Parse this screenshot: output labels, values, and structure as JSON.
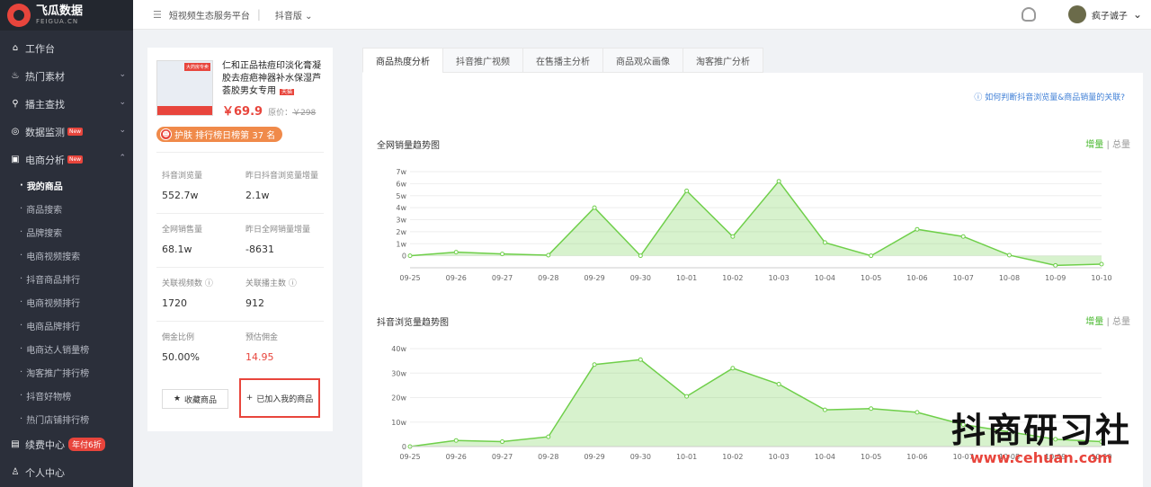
{
  "app": {
    "logo_name": "飞瓜数据",
    "logo_sub": "FEIGUA.CN"
  },
  "topbar": {
    "menu_icon": "menu-icon",
    "platform": "短视频生态服务平台",
    "separator": "|",
    "version": "抖音版",
    "username": "疯子诚子"
  },
  "sidebar": {
    "items": [
      {
        "label": "工作台",
        "icon": "home-icon",
        "glyph": "⌂"
      },
      {
        "label": "热门素材",
        "icon": "fire-icon",
        "glyph": "♨",
        "chevron": "⌄"
      },
      {
        "label": "播主查找",
        "icon": "search-icon",
        "glyph": "⚲",
        "chevron": "⌄"
      },
      {
        "label": "数据监测",
        "icon": "monitor-icon",
        "glyph": "◎",
        "badge": "New",
        "chevron": "⌄"
      },
      {
        "label": "电商分析",
        "icon": "shop-icon",
        "glyph": "▣",
        "badge": "New",
        "chevron": "⌃"
      }
    ],
    "sub_items": [
      "我的商品",
      "商品搜索",
      "品牌搜索",
      "电商视频搜索",
      "抖音商品排行",
      "电商视频排行",
      "电商品牌排行",
      "电商达人销量榜",
      "淘客推广排行榜",
      "抖音好物榜",
      "热门店铺排行榜"
    ],
    "bottom": [
      {
        "label": "续费中心",
        "icon": "renew-icon",
        "glyph": "▤",
        "badge": "年付6折"
      },
      {
        "label": "个人中心",
        "icon": "user-icon",
        "glyph": "♙"
      }
    ]
  },
  "product": {
    "title": "仁和正品祛痘印淡化膏凝胶去痘疤神器补水保湿芦荟胶男女专用",
    "shop_tag": "天猫",
    "image_tag": "大药房专卖",
    "price": "￥69.9",
    "original_label": "原价：",
    "original_price": "￥298",
    "rank_icon": "rank-icon",
    "rank_text": "护肤 排行榜日榜第 37 名",
    "stats": [
      {
        "label": "抖音浏览量",
        "value": "552.7w"
      },
      {
        "label": "昨日抖音浏览量增量",
        "value": "2.1w"
      },
      {
        "label": "全网销售量",
        "value": "68.1w"
      },
      {
        "label": "昨日全网销量增量",
        "value": "-8631"
      },
      {
        "label": "关联视频数 ⓘ",
        "value": "1720"
      },
      {
        "label": "关联播主数 ⓘ",
        "value": "912"
      },
      {
        "label": "佣金比例",
        "value": "50.00%"
      },
      {
        "label": "预估佣金",
        "value": "14.95"
      }
    ],
    "fav_button": "收藏商品",
    "added_button": "已加入我的商品"
  },
  "tabs": [
    "商品热度分析",
    "抖音推广视频",
    "在售播主分析",
    "商品观众画像",
    "淘客推广分析"
  ],
  "help_link": "ⓘ 如何判断抖音浏览量&商品销量的关联?",
  "toggle": {
    "on": "增量",
    "sep": "|",
    "off": "总量"
  },
  "accent": "#49b82f",
  "chart_data": [
    {
      "type": "area",
      "title": "全网销量趋势图",
      "x": [
        "09-25",
        "09-26",
        "09-27",
        "09-28",
        "09-29",
        "09-30",
        "10-01",
        "10-02",
        "10-03",
        "10-04",
        "10-05",
        "10-06",
        "10-07",
        "10-08",
        "10-09",
        "10-10"
      ],
      "values": [
        0,
        0.3,
        0.15,
        0.05,
        4.0,
        0.0,
        5.4,
        1.6,
        6.2,
        1.1,
        0.0,
        2.2,
        1.6,
        0.05,
        -0.8,
        -0.7
      ],
      "ylim": [
        -1,
        7
      ],
      "yticks": [
        0,
        1,
        2,
        3,
        4,
        5,
        6,
        7
      ],
      "ytick_labels": [
        "0",
        "1w",
        "2w",
        "3w",
        "4w",
        "5w",
        "6w",
        "7w"
      ],
      "color": "#6fcf4a"
    },
    {
      "type": "area",
      "title": "抖音浏览量趋势图",
      "x": [
        "09-25",
        "09-26",
        "09-27",
        "09-28",
        "09-29",
        "09-30",
        "10-01",
        "10-02",
        "10-03",
        "10-04",
        "10-05",
        "10-06",
        "10-07",
        "10-08",
        "10-09",
        "10-10"
      ],
      "values": [
        0,
        2.5,
        2.0,
        4.0,
        33.5,
        35.5,
        20.5,
        32.0,
        25.5,
        15.0,
        15.5,
        14.0,
        9.0,
        6.0,
        3.0,
        2.0
      ],
      "ylim": [
        0,
        40
      ],
      "yticks": [
        0,
        10,
        20,
        30,
        40
      ],
      "ytick_labels": [
        "0",
        "10w",
        "20w",
        "30w",
        "40w"
      ],
      "color": "#6fcf4a"
    }
  ],
  "watermark": {
    "main": "抖商研习社",
    "url": "www.cehuan.com"
  }
}
